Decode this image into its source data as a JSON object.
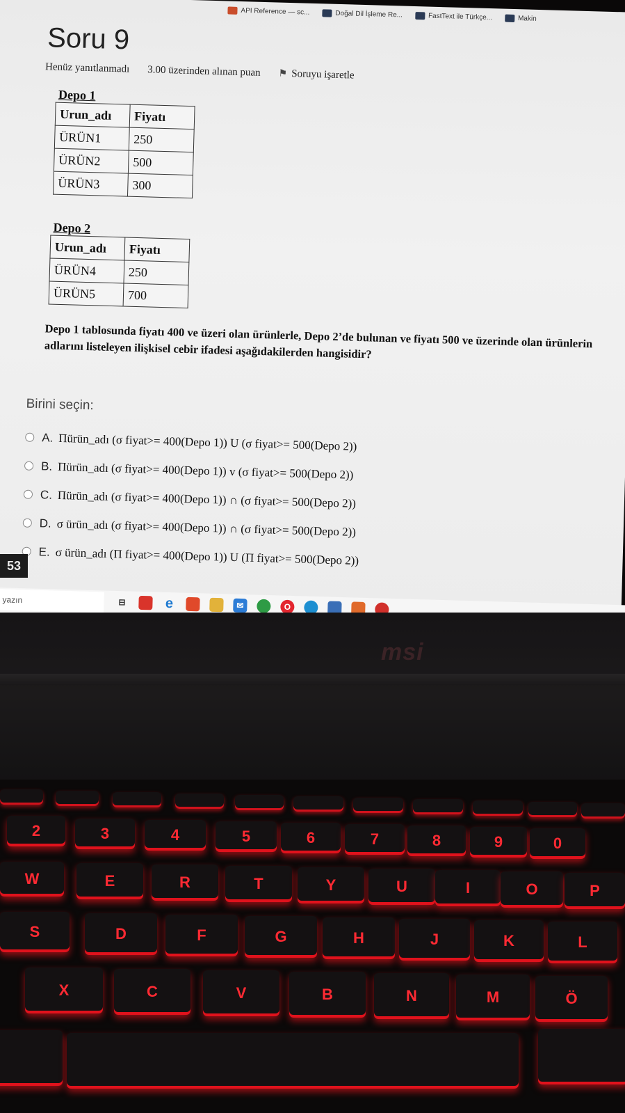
{
  "browser": {
    "bookmarks": [
      {
        "label": "API Reference — sc...",
        "icon": "bookmark-red-icon"
      },
      {
        "label": "Doğal Dil İşleme Re...",
        "icon": "bookmark-dark-icon"
      },
      {
        "label": "FastText ile Türkçe...",
        "icon": "bookmark-dark-icon"
      },
      {
        "label": "Makin",
        "icon": "bookmark-dark-icon"
      }
    ]
  },
  "quiz": {
    "title": "Soru 9",
    "status": "Henüz yanıtlanmadı",
    "points": "3.00 üzerinden alınan puan",
    "flag_label": "Soruyu işaretle",
    "depo1": {
      "title": "Depo 1",
      "headers": [
        "Urun_adı",
        "Fiyatı"
      ],
      "rows": [
        [
          "ÜRÜN1",
          "250"
        ],
        [
          "ÜRÜN2",
          "500"
        ],
        [
          "ÜRÜN3",
          "300"
        ]
      ]
    },
    "depo2": {
      "title": "Depo 2",
      "headers": [
        "Urun_adı",
        "Fiyatı"
      ],
      "rows": [
        [
          "ÜRÜN4",
          "250"
        ],
        [
          "ÜRÜN5",
          "700"
        ]
      ]
    },
    "question": "Depo 1 tablosunda fiyatı 400 ve üzeri olan ürünlerle, Depo 2’de bulunan ve fiyatı 500 ve üzerinde olan ürünlerin adlarını listeleyen ilişkisel cebir ifadesi aşağıdakilerden hangisidir?",
    "choose_label": "Birini seçin:",
    "options": [
      {
        "letter": "A.",
        "text": "Πürün_adı (σ fiyat>= 400(Depo 1)) U (σ fiyat>= 500(Depo 2))"
      },
      {
        "letter": "B.",
        "text": "Πürün_adı (σ fiyat>= 400(Depo 1)) v (σ fiyat>= 500(Depo 2))"
      },
      {
        "letter": "C.",
        "text": "Πürün_adı (σ fiyat>= 400(Depo 1)) ∩ (σ fiyat>= 500(Depo 2))"
      },
      {
        "letter": "D.",
        "text": "σ ürün_adı (σ fiyat>= 400(Depo 1)) ∩ (σ fiyat>= 500(Depo 2))"
      },
      {
        "letter": "E.",
        "text": "σ ürün_adı (Π fiyat>= 400(Depo 1)) U (Π fiyat>= 500(Depo 2))"
      }
    ]
  },
  "taskbar": {
    "clock_fragment": "53",
    "search_placeholder": "yazın"
  },
  "laptop": {
    "brand": "msi",
    "keys_row1": [
      "2",
      "3",
      "4",
      "5",
      "6",
      "7",
      "8",
      "9",
      "0"
    ],
    "keys_row2": [
      "W",
      "E",
      "R",
      "T",
      "Y",
      "U",
      "I",
      "O",
      "P"
    ],
    "keys_row3": [
      "S",
      "D",
      "F",
      "G",
      "H",
      "J",
      "K",
      "L"
    ],
    "keys_row4": [
      "X",
      "C",
      "V",
      "B",
      "N",
      "M",
      "Ö"
    ]
  },
  "colors": {
    "key_glow": "#ff2a33",
    "screen_bg": "#efefef"
  }
}
